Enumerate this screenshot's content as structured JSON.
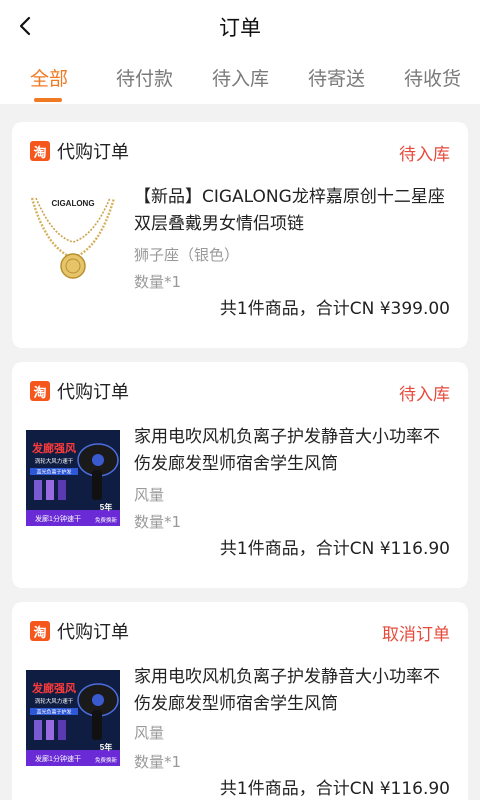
{
  "header": {
    "title": "订单"
  },
  "tabs": [
    {
      "label": "全部",
      "active": true
    },
    {
      "label": "待付款"
    },
    {
      "label": "待入库"
    },
    {
      "label": "待寄送"
    },
    {
      "label": "待收货"
    }
  ],
  "colors": {
    "accent": "#f07a22",
    "status": "#e74a3b",
    "taobao": "#f5561c"
  },
  "orders": [
    {
      "type": "代购订单",
      "status": "待入库",
      "product": {
        "name": "【新品】CIGALONG龙梓嘉原创十二星座双层叠戴男女情侣项链",
        "spec": "狮子座（银色）",
        "qty": "数量*1",
        "brand_text": "CIGALONG"
      },
      "total": "共1件商品，合计CN ¥399.00"
    },
    {
      "type": "代购订单",
      "status": "待入库",
      "product": {
        "name": "家用电吹风机负离子护发静音大小功率不伤发廊发型师宿舍学生风筒",
        "spec": "风量",
        "qty": "数量*1",
        "img_texts": [
          "发廊强风",
          "涡轮大风力速干",
          "蓝光负离子护发",
          "发廊1分钟速干",
          "5年",
          "免费换新"
        ]
      },
      "total": "共1件商品，合计CN ¥116.90"
    },
    {
      "type": "代购订单",
      "status": "取消订单",
      "product": {
        "name": "家用电吹风机负离子护发静音大小功率不伤发廊发型师宿舍学生风筒",
        "spec": "风量",
        "qty": "数量*1",
        "img_texts": [
          "发廊强风",
          "涡轮大风力速干",
          "蓝光负离子护发",
          "发廊1分钟速干",
          "5年",
          "免费换新"
        ]
      },
      "total": "共1件商品，合计CN ¥116.90"
    }
  ]
}
